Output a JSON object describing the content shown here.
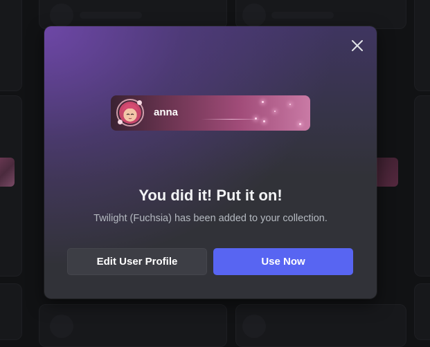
{
  "modal": {
    "close_icon": "close-icon",
    "nameplate": {
      "username": "anna",
      "avatar": "avatar-anime-girl"
    },
    "headline": "You did it! Put it on!",
    "subline": "Twilight (Fuchsia) has been added to your collection.",
    "buttons": {
      "edit_profile": "Edit User Profile",
      "use_now": "Use Now"
    }
  },
  "colors": {
    "primary_button": "#5865f2",
    "secondary_button": "#3d3e45",
    "modal_bg": "#313238",
    "accent_purple": "#7048aa"
  }
}
